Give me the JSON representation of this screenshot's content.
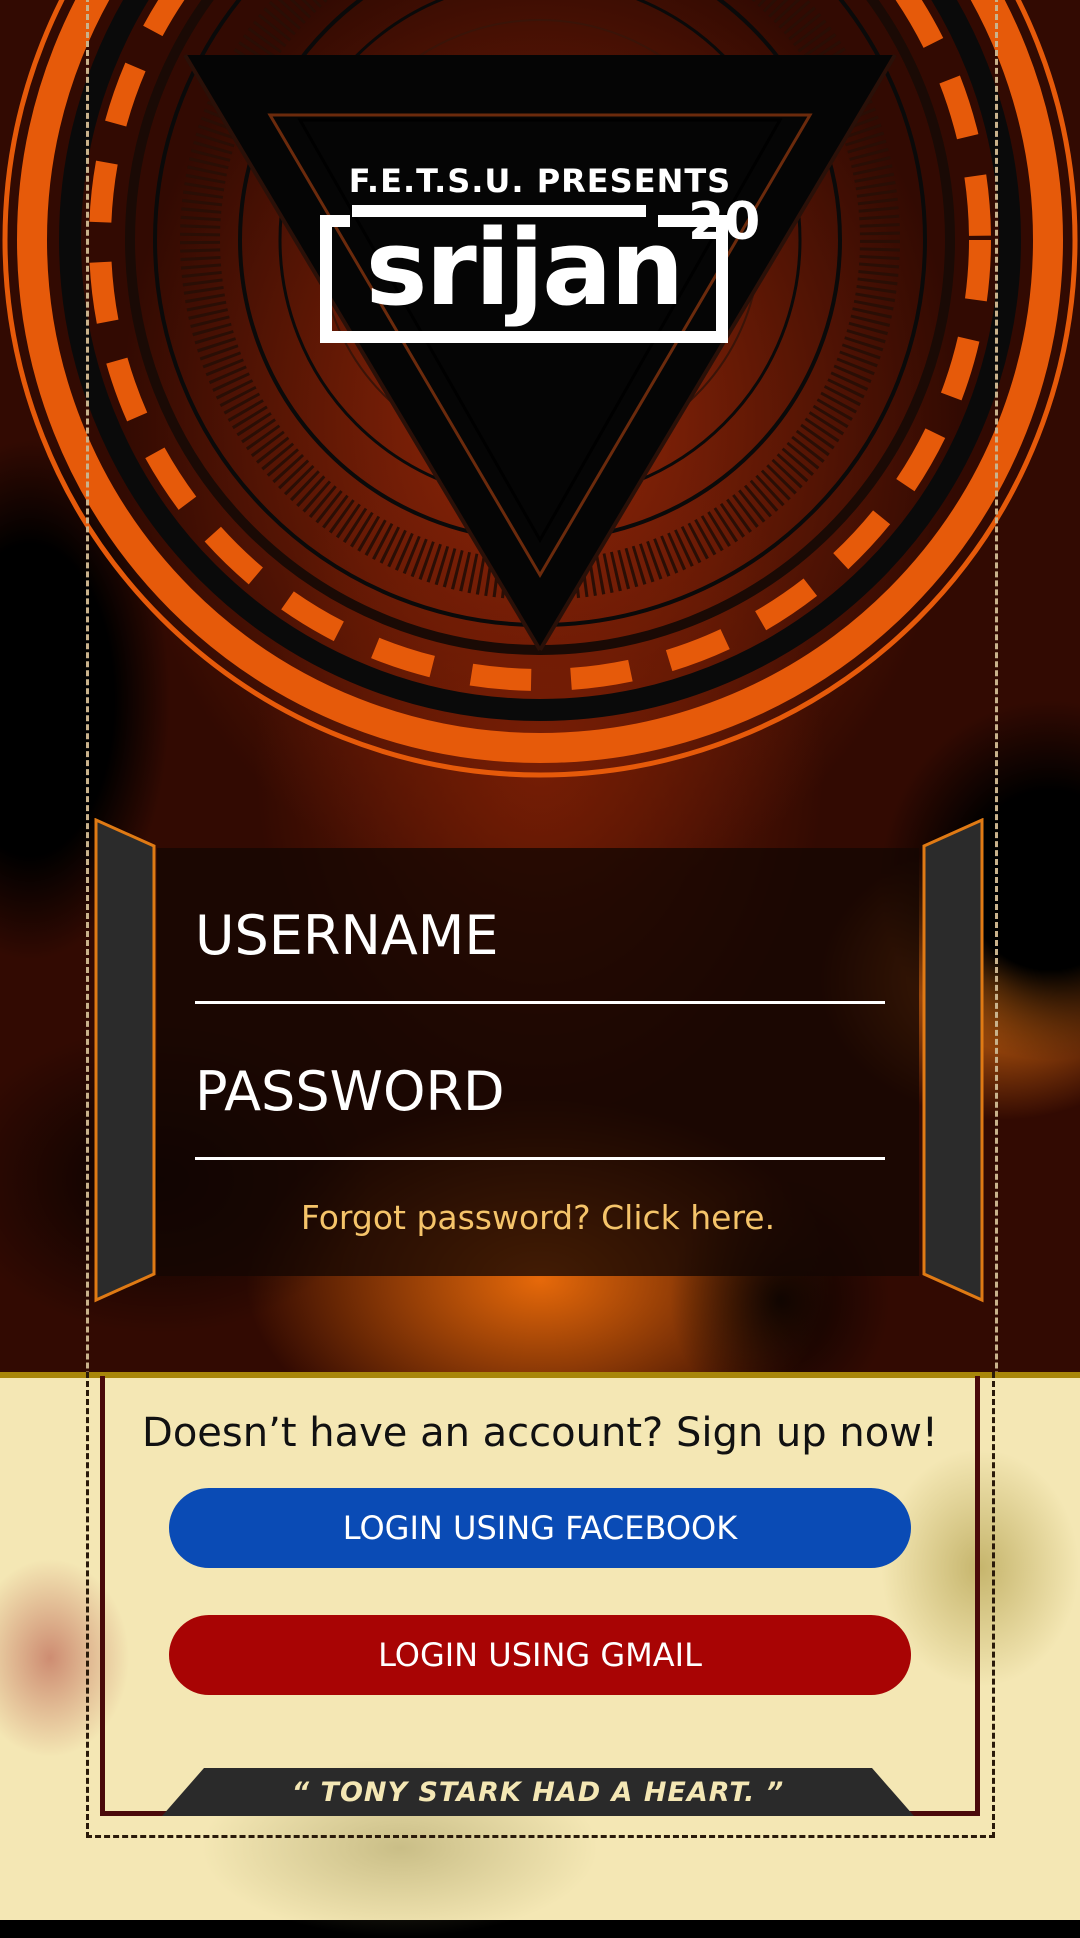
{
  "header": {
    "presenter": "F.E.T.S.U. PRESENTS",
    "brand_word": "srijan",
    "brand_year": "20"
  },
  "login": {
    "username_placeholder": "USERNAME",
    "password_placeholder": "PASSWORD",
    "forgot_link": "Forgot password? Click here."
  },
  "signup": {
    "prompt": "Doesn’t have an account? Sign up now!",
    "facebook_button": "LOGIN USING FACEBOOK",
    "gmail_button": "LOGIN USING GMAIL",
    "quote": "“ TONY STARK HAD A HEART. ”"
  },
  "colors": {
    "accent_orange": "#e65a0a",
    "facebook_blue": "#0a4bb5",
    "gmail_red": "#a80404",
    "link_gold": "#f5c46a"
  }
}
